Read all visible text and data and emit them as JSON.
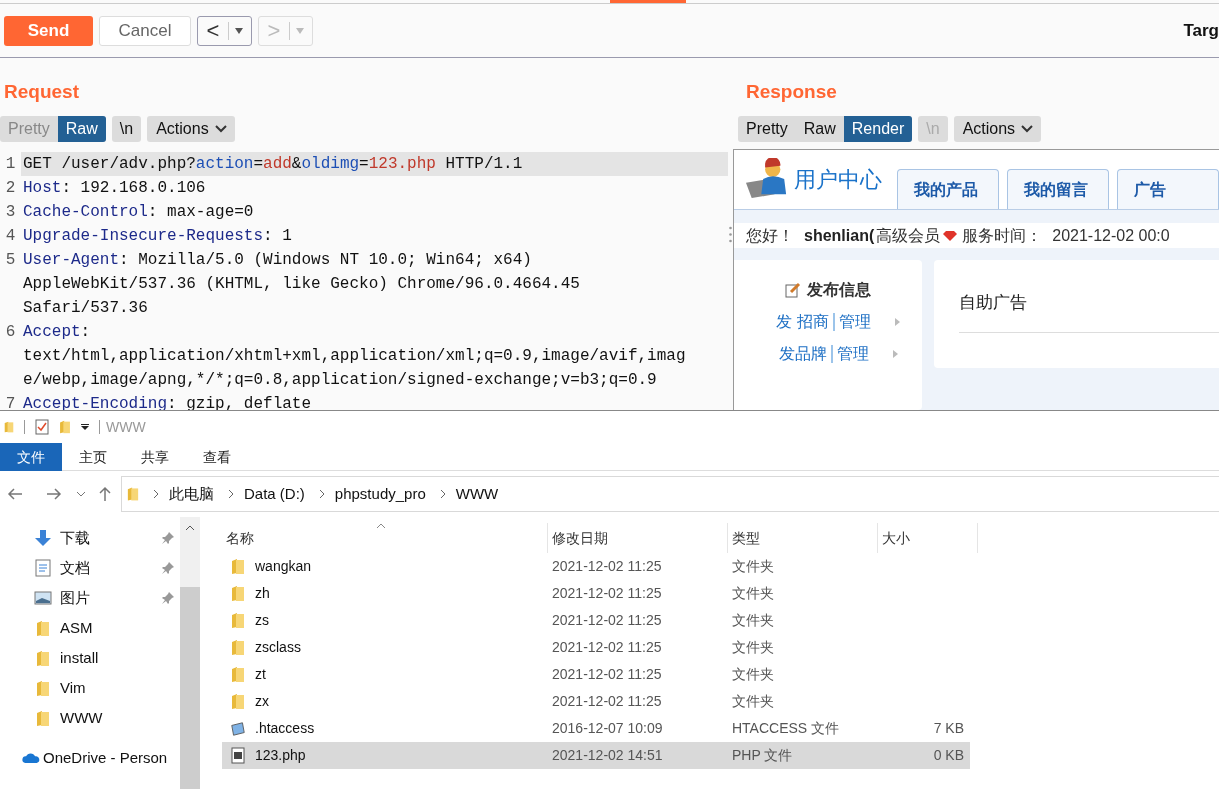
{
  "toolbar": {
    "send": "Send",
    "cancel": "Cancel",
    "back": {
      "label": "<",
      "disabled": false
    },
    "forward": {
      "label": ">",
      "disabled": true
    },
    "target": "Targ"
  },
  "request": {
    "title": "Request",
    "view_tabs": [
      {
        "label": "Pretty",
        "selected": false
      },
      {
        "label": "Raw",
        "selected": true
      }
    ],
    "newline": {
      "label": "\\n",
      "disabled": false
    },
    "actions": "Actions",
    "lines": [
      {
        "number": "1",
        "highlighted": true,
        "segments": [
          {
            "kind": "plain",
            "text": "GET /user/adv.php?"
          },
          {
            "kind": "param",
            "text": "action"
          },
          {
            "kind": "plain",
            "text": "="
          },
          {
            "kind": "value",
            "text": "add"
          },
          {
            "kind": "plain",
            "text": "&"
          },
          {
            "kind": "param",
            "text": "oldimg"
          },
          {
            "kind": "plain",
            "text": "="
          },
          {
            "kind": "value",
            "text": "123.php"
          },
          {
            "kind": "plain",
            "text": " HTTP/1.1"
          }
        ]
      },
      {
        "number": "2",
        "highlighted": false,
        "segments": [
          {
            "kind": "key",
            "text": "Host"
          },
          {
            "kind": "plain",
            "text": ": 192.168.0.106"
          }
        ]
      },
      {
        "number": "3",
        "highlighted": false,
        "segments": [
          {
            "kind": "key",
            "text": "Cache-Control"
          },
          {
            "kind": "plain",
            "text": ": max-age=0"
          }
        ]
      },
      {
        "number": "4",
        "highlighted": false,
        "segments": [
          {
            "kind": "key",
            "text": "Upgrade-Insecure-Requests"
          },
          {
            "kind": "plain",
            "text": ": 1"
          }
        ]
      },
      {
        "number": "5",
        "highlighted": false,
        "segments": [
          {
            "kind": "key",
            "text": "User-Agent"
          },
          {
            "kind": "plain",
            "text": ": Mozilla/5.0 (Windows NT 10.0; Win64; x64)"
          }
        ]
      },
      {
        "highlighted": false,
        "segments": [
          {
            "kind": "plain",
            "text": "AppleWebKit/537.36 (KHTML, like Gecko) Chrome/96.0.4664.45"
          }
        ]
      },
      {
        "highlighted": false,
        "segments": [
          {
            "kind": "plain",
            "text": "Safari/537.36"
          }
        ]
      },
      {
        "number": "6",
        "highlighted": false,
        "segments": [
          {
            "kind": "key",
            "text": "Accept"
          },
          {
            "kind": "plain",
            "text": ":"
          }
        ]
      },
      {
        "highlighted": false,
        "segments": [
          {
            "kind": "plain",
            "text": "text/html,application/xhtml+xml,application/xml;q=0.9,image/avif,imag"
          }
        ]
      },
      {
        "highlighted": false,
        "segments": [
          {
            "kind": "plain",
            "text": "e/webp,image/apng,*/*;q=0.8,application/signed-exchange;v=b3;q=0.9"
          }
        ]
      },
      {
        "number": "7",
        "highlighted": false,
        "segments": [
          {
            "kind": "key",
            "text": "Accept-Encoding"
          },
          {
            "kind": "plain",
            "text": ": gzip, deflate"
          }
        ]
      }
    ]
  },
  "response": {
    "title": "Response",
    "view_tabs": [
      {
        "label": "Pretty",
        "selected": false
      },
      {
        "label": "Raw",
        "selected": false
      },
      {
        "label": "Render",
        "selected": true
      }
    ],
    "newline": {
      "label": "\\n",
      "disabled": true
    },
    "actions": "Actions",
    "render": {
      "site_title": "用户中心",
      "tabs": [
        "我的产品",
        "我的留言",
        "广告"
      ],
      "greeting": "您好！",
      "username": "shenlian(",
      "level": "高级会员",
      "service_label": "服务时间：",
      "service_time": "2021-12-02 00:0",
      "publish_title": "发布信息",
      "publish_links": [
        {
          "post": "发 招商",
          "manage": "管理"
        },
        {
          "post": "发品牌",
          "manage": "管理"
        }
      ],
      "ad_title": "自助广告"
    }
  },
  "explorer": {
    "title": "WWW",
    "ribbon_tabs": [
      {
        "label": "文件",
        "selected": true
      },
      {
        "label": "主页",
        "selected": false
      },
      {
        "label": "共享",
        "selected": false
      },
      {
        "label": "查看",
        "selected": false
      }
    ],
    "breadcrumb": [
      "此电脑",
      "Data (D:)",
      "phpstudy_pro",
      "WWW"
    ],
    "sidebar": [
      {
        "kind": "download",
        "label": "下载",
        "pinned": true
      },
      {
        "kind": "document",
        "label": "文档",
        "pinned": true
      },
      {
        "kind": "pictures",
        "label": "图片",
        "pinned": true
      },
      {
        "kind": "folder",
        "label": "ASM",
        "pinned": false
      },
      {
        "kind": "folder",
        "label": "install",
        "pinned": false
      },
      {
        "kind": "folder",
        "label": "Vim",
        "pinned": false
      },
      {
        "kind": "folder",
        "label": "WWW",
        "pinned": false
      },
      {
        "kind": "cloud",
        "label": "OneDrive - Person",
        "pinned": false
      }
    ],
    "columns": [
      "名称",
      "修改日期",
      "类型",
      "大小"
    ],
    "rows": [
      {
        "kind": "folder",
        "name": "wangkan",
        "date": "2021-12-02 11:25",
        "type": "文件夹",
        "selected": false
      },
      {
        "kind": "folder",
        "name": "zh",
        "date": "2021-12-02 11:25",
        "type": "文件夹",
        "selected": false
      },
      {
        "kind": "folder",
        "name": "zs",
        "date": "2021-12-02 11:25",
        "type": "文件夹",
        "selected": false
      },
      {
        "kind": "folder",
        "name": "zsclass",
        "date": "2021-12-02 11:25",
        "type": "文件夹",
        "selected": false
      },
      {
        "kind": "folder",
        "name": "zt",
        "date": "2021-12-02 11:25",
        "type": "文件夹",
        "selected": false
      },
      {
        "kind": "folder",
        "name": "zx",
        "date": "2021-12-02 11:25",
        "type": "文件夹",
        "selected": false
      },
      {
        "kind": "htaccess",
        "name": ".htaccess",
        "date": "2016-12-07 10:09",
        "type": "HTACCESS 文件",
        "size": "7 KB",
        "selected": false
      },
      {
        "kind": "php",
        "name": "123.php",
        "date": "2021-12-02 14:51",
        "type": "PHP 文件",
        "size": "0 KB",
        "selected": true
      }
    ]
  }
}
